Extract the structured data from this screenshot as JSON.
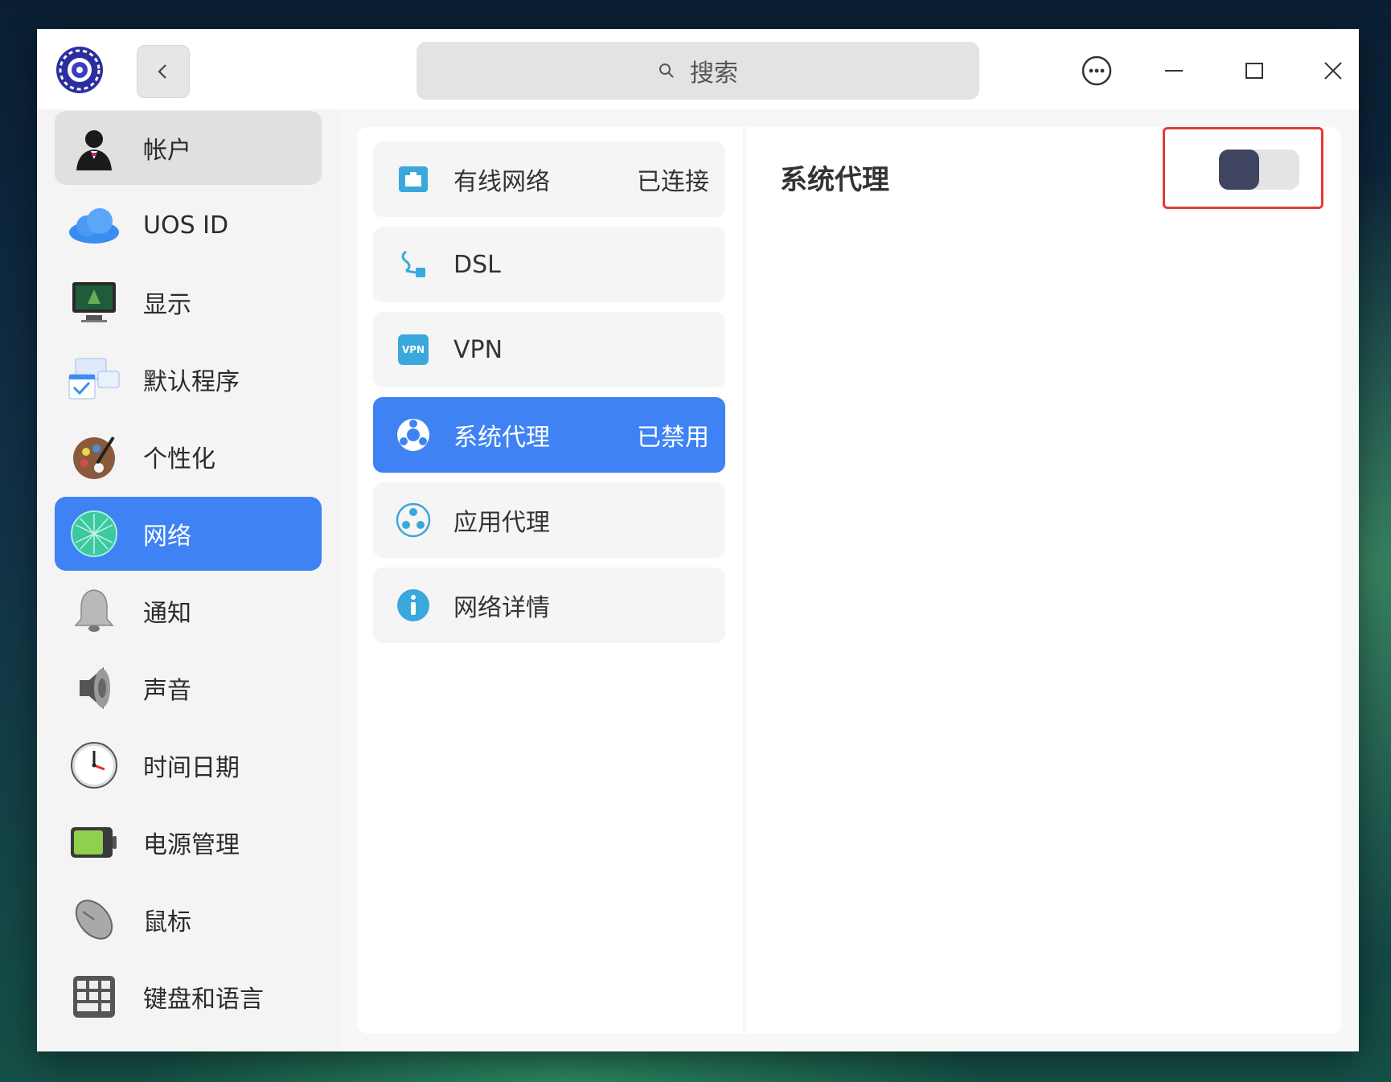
{
  "search": {
    "placeholder": "搜索"
  },
  "sidebar": {
    "items": [
      {
        "label": "帐户",
        "icon": "account-icon"
      },
      {
        "label": "UOS ID",
        "icon": "cloud-icon"
      },
      {
        "label": "显示",
        "icon": "display-icon"
      },
      {
        "label": "默认程序",
        "icon": "default-apps-icon"
      },
      {
        "label": "个性化",
        "icon": "palette-icon"
      },
      {
        "label": "网络",
        "icon": "network-icon",
        "active": true
      },
      {
        "label": "通知",
        "icon": "bell-icon"
      },
      {
        "label": "声音",
        "icon": "speaker-icon"
      },
      {
        "label": "时间日期",
        "icon": "clock-icon"
      },
      {
        "label": "电源管理",
        "icon": "battery-icon"
      },
      {
        "label": "鼠标",
        "icon": "mouse-icon"
      },
      {
        "label": "键盘和语言",
        "icon": "keyboard-icon"
      }
    ]
  },
  "network_menu": {
    "items": [
      {
        "label": "有线网络",
        "status": "已连接",
        "icon": "wired-network-icon"
      },
      {
        "label": "DSL",
        "status": "",
        "icon": "dsl-icon"
      },
      {
        "label": "VPN",
        "status": "",
        "icon": "vpn-icon"
      },
      {
        "label": "系统代理",
        "status": "已禁用",
        "icon": "system-proxy-icon",
        "active": true
      },
      {
        "label": "应用代理",
        "status": "",
        "icon": "app-proxy-icon"
      },
      {
        "label": "网络详情",
        "status": "",
        "icon": "info-icon"
      }
    ]
  },
  "content": {
    "title": "系统代理",
    "proxy_enabled": false
  },
  "colors": {
    "accent": "#3f82f4",
    "highlight_box": "#e53935",
    "toggle_knob": "#3f4561"
  },
  "icons": {
    "vpn_badge": "VPN"
  }
}
